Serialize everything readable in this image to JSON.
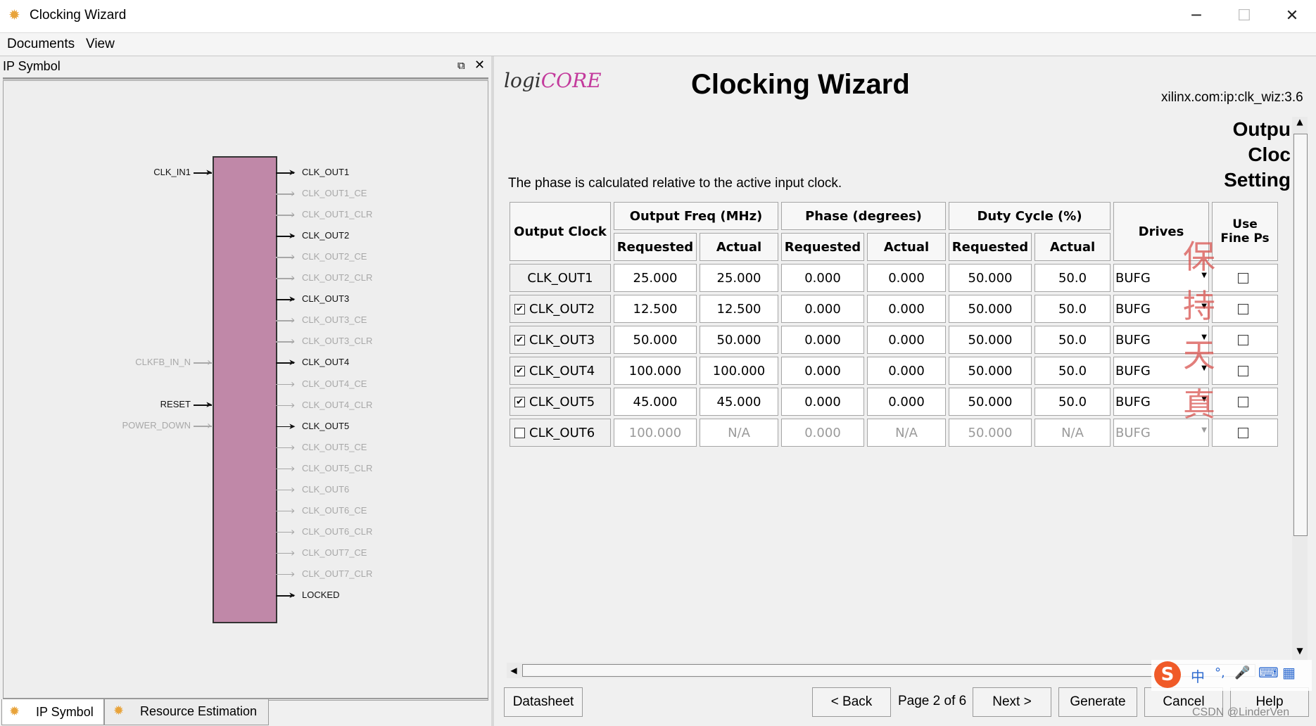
{
  "window": {
    "title": "Clocking Wizard",
    "minimize": "─",
    "maximize": "☐",
    "close": "✕"
  },
  "menu": {
    "documents": "Documents",
    "view": "View"
  },
  "left_panel": {
    "title": "IP Symbol",
    "inputs": [
      {
        "label": "CLK_IN1",
        "active": true
      },
      {
        "label": "CLKFB_IN_N",
        "active": false
      },
      {
        "label": "RESET",
        "active": true
      },
      {
        "label": "POWER_DOWN",
        "active": false
      }
    ],
    "outputs": [
      {
        "label": "CLK_OUT1",
        "active": true
      },
      {
        "label": "CLK_OUT1_CE",
        "active": false
      },
      {
        "label": "CLK_OUT1_CLR",
        "active": false
      },
      {
        "label": "CLK_OUT2",
        "active": true
      },
      {
        "label": "CLK_OUT2_CE",
        "active": false
      },
      {
        "label": "CLK_OUT2_CLR",
        "active": false
      },
      {
        "label": "CLK_OUT3",
        "active": true
      },
      {
        "label": "CLK_OUT3_CE",
        "active": false
      },
      {
        "label": "CLK_OUT3_CLR",
        "active": false
      },
      {
        "label": "CLK_OUT4",
        "active": true
      },
      {
        "label": "CLK_OUT4_CE",
        "active": false
      },
      {
        "label": "CLK_OUT4_CLR",
        "active": false
      },
      {
        "label": "CLK_OUT5",
        "active": true
      },
      {
        "label": "CLK_OUT5_CE",
        "active": false
      },
      {
        "label": "CLK_OUT5_CLR",
        "active": false
      },
      {
        "label": "CLK_OUT6",
        "active": false
      },
      {
        "label": "CLK_OUT6_CE",
        "active": false
      },
      {
        "label": "CLK_OUT6_CLR",
        "active": false
      },
      {
        "label": "CLK_OUT7_CE",
        "active": false
      },
      {
        "label": "CLK_OUT7_CLR",
        "active": false
      },
      {
        "label": "LOCKED",
        "active": true
      }
    ],
    "tabs": [
      "IP Symbol",
      "Resource Estimation"
    ]
  },
  "header": {
    "logo_prefix": "logi",
    "logo_suffix": "CORE",
    "title": "Clocking Wizard",
    "ip_id": "xilinx.com:ip:clk_wiz:3.6",
    "side_title": [
      "Outpu",
      "Cloc",
      "Setting"
    ]
  },
  "note": "The phase is calculated relative to the active input clock.",
  "table": {
    "headers": {
      "output_clock": "Output Clock",
      "freq": "Output Freq (MHz)",
      "phase": "Phase (degrees)",
      "duty": "Duty Cycle (%)",
      "drives": "Drives",
      "fine_ps_1": "Use",
      "fine_ps_2": "Fine Ps",
      "requested": "Requested",
      "actual": "Actual"
    },
    "rows": [
      {
        "name": "CLK_OUT1",
        "checkbox": null,
        "enabled": true,
        "freq_req": "25.000",
        "freq_act": "25.000",
        "ph_req": "0.000",
        "ph_act": "0.000",
        "duty_req": "50.000",
        "duty_act": "50.0",
        "drives": "BUFG"
      },
      {
        "name": "CLK_OUT2",
        "checkbox": true,
        "enabled": true,
        "freq_req": "12.500",
        "freq_act": "12.500",
        "ph_req": "0.000",
        "ph_act": "0.000",
        "duty_req": "50.000",
        "duty_act": "50.0",
        "drives": "BUFG"
      },
      {
        "name": "CLK_OUT3",
        "checkbox": true,
        "enabled": true,
        "freq_req": "50.000",
        "freq_act": "50.000",
        "ph_req": "0.000",
        "ph_act": "0.000",
        "duty_req": "50.000",
        "duty_act": "50.0",
        "drives": "BUFG"
      },
      {
        "name": "CLK_OUT4",
        "checkbox": true,
        "enabled": true,
        "freq_req": "100.000",
        "freq_act": "100.000",
        "ph_req": "0.000",
        "ph_act": "0.000",
        "duty_req": "50.000",
        "duty_act": "50.0",
        "drives": "BUFG"
      },
      {
        "name": "CLK_OUT5",
        "checkbox": true,
        "enabled": true,
        "freq_req": "45.000",
        "freq_act": "45.000",
        "ph_req": "0.000",
        "ph_act": "0.000",
        "duty_req": "50.000",
        "duty_act": "50.0",
        "drives": "BUFG"
      },
      {
        "name": "CLK_OUT6",
        "checkbox": false,
        "enabled": false,
        "freq_req": "100.000",
        "freq_act": "N/A",
        "ph_req": "0.000",
        "ph_act": "N/A",
        "duty_req": "50.000",
        "duty_act": "N/A",
        "drives": "BUFG"
      }
    ]
  },
  "watermark": {
    "chars": [
      "保",
      "持",
      "天",
      "真"
    ],
    "color": "#d9534f"
  },
  "footer": {
    "datasheet": "Datasheet",
    "back": "< Back",
    "page": "Page 2 of 6",
    "next": "Next >",
    "generate": "Generate",
    "cancel": "Cancel",
    "help": "Help",
    "csdn": "CSDN @LinderVen",
    "ime": [
      "S",
      "中",
      "°,",
      "🎤",
      "⌨",
      "▦"
    ]
  },
  "colors": {
    "symbol_block": "#c088a8",
    "accent": "#2e6bd0"
  }
}
